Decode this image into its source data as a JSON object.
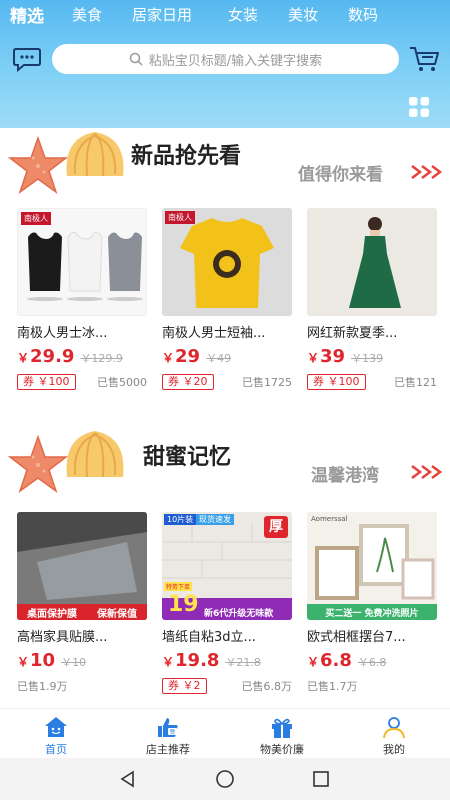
{
  "search": {
    "placeholder": "粘贴宝贝标题/输入关键字搜索"
  },
  "categories": [
    "精选",
    "美食",
    "居家日用",
    "女装",
    "美妆",
    "数码"
  ],
  "section1": {
    "title": "新品抢先看",
    "subtitle": "值得你来看"
  },
  "section2": {
    "title": "甜蜜记忆",
    "subtitle": "温馨港湾"
  },
  "products_new": [
    {
      "name": "南极人男士冰...",
      "currency": "￥",
      "price": "29.9",
      "original": "￥129.9",
      "coupon": "券 ￥100",
      "sold": "已售5000",
      "brand_tag": "南极人"
    },
    {
      "name": "南极人男士短袖...",
      "currency": "￥",
      "price": "29",
      "original": "￥49",
      "coupon": "券 ￥20",
      "sold": "已售1725",
      "brand_tag": "南极人"
    },
    {
      "name": "网红新款夏季...",
      "currency": "￥",
      "price": "39",
      "original": "￥139",
      "coupon": "券 ￥100",
      "sold": "已售121"
    }
  ],
  "products_sweet": [
    {
      "name": "高档家具贴膜...",
      "currency": "￥",
      "price": "10",
      "original": "￥10",
      "sold": "已售1.9万",
      "img_text_1": "桌面保护膜",
      "img_text_2": "保新保值"
    },
    {
      "name": "墙纸自粘3d立...",
      "currency": "￥",
      "price": "19.8",
      "original": "￥21.8",
      "coupon": "券 ￥2",
      "sold": "已售6.8万",
      "img_tag_1": "10片装",
      "img_tag_2": "现货速发",
      "img_tag_3": "厚",
      "img_big": "19",
      "img_sub": "新6代升级无味款",
      "img_small": "特势下单"
    },
    {
      "name": "欧式相框摆台7...",
      "currency": "￥",
      "price": "6.8",
      "original": "￥6.8",
      "sold": "已售1.7万",
      "img_brand": "Aomerssal",
      "img_banner": "买二送一 免费冲洗照片"
    }
  ],
  "tabbar": [
    {
      "label": "首页",
      "icon": "home-icon",
      "active": true
    },
    {
      "label": "店主推荐",
      "icon": "thumbs-up-icon",
      "badge": "赞"
    },
    {
      "label": "物美价廉",
      "icon": "gift-icon"
    },
    {
      "label": "我的",
      "icon": "user-icon"
    }
  ],
  "colors": {
    "header": "#56b8f0",
    "price": "#e0262d",
    "active_tab": "#2a7de1",
    "shell": "#f08a5d",
    "starfish": "#ef8a68"
  }
}
